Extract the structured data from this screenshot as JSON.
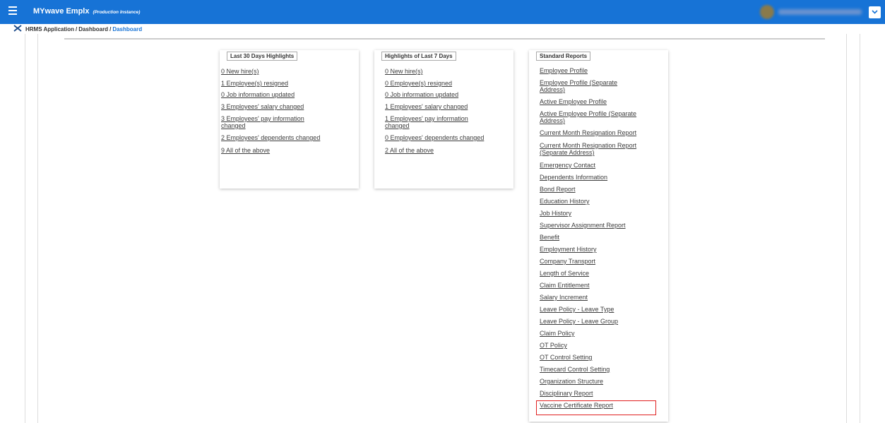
{
  "header": {
    "menu_icon": "hamburger-icon",
    "title": "MYwave Emplx",
    "instance": "(Production Instance)",
    "user_dropdown_icon": "chevron-down-icon"
  },
  "breadcrumb": {
    "icon": "close-x-icon",
    "items": [
      "HRMS Application",
      "Dashboard",
      "Dashboard"
    ]
  },
  "cards": [
    {
      "title": "Last 30 Days Highlights",
      "links": [
        [
          "0 New hire(s)"
        ],
        [
          "1 Employee(s) resigned"
        ],
        [
          "0 Job information updated"
        ],
        [
          "3 Employees' salary changed"
        ],
        [
          "3 Employees' pay information",
          "changed"
        ],
        [
          "2 Employees' dependents changed"
        ],
        [
          "9 All of the above"
        ]
      ]
    },
    {
      "title": "Highlights of Last 7 Days",
      "links": [
        [
          "0 New hire(s)"
        ],
        [
          "0 Employee(s) resigned"
        ],
        [
          "0 Job information updated"
        ],
        [
          "1 Employees' salary changed"
        ],
        [
          "1 Employees' pay information",
          "changed"
        ],
        [
          "0 Employees' dependents changed"
        ],
        [
          "2 All of the above"
        ]
      ]
    },
    {
      "title": "Standard Reports",
      "links": [
        [
          "Employee Profile"
        ],
        [
          "Employee Profile (Separate",
          "Address)"
        ],
        [
          "Active Employee Profile"
        ],
        [
          "Active Employee Profile (Separate",
          "Address)"
        ],
        [
          "Current Month Resignation Report"
        ],
        [
          "Current Month Resignation Report",
          "(Separate Address)"
        ],
        [
          "Emergency Contact"
        ],
        [
          "Dependents Information"
        ],
        [
          "Bond Report"
        ],
        [
          "Education History"
        ],
        [
          "Job History"
        ],
        [
          "Supervisor Assignment Report"
        ],
        [
          "Benefit"
        ],
        [
          "Employment History"
        ],
        [
          "Company Transport"
        ],
        [
          "Length of Service"
        ],
        [
          "Claim Entitlement"
        ],
        [
          "Salary Increment"
        ],
        [
          "Leave Policy - Leave Type"
        ],
        [
          "Leave Policy - Leave Group"
        ],
        [
          "Claim Policy"
        ],
        [
          "OT Policy"
        ],
        [
          "OT Control Setting"
        ],
        [
          "Timecard Control Setting"
        ],
        [
          "Organization Structure"
        ],
        [
          "Disciplinary Report"
        ],
        [
          "Vaccine Certificate Report"
        ]
      ]
    }
  ],
  "colors": {
    "header": "#1773d6",
    "highlight_box": "#e02020"
  }
}
